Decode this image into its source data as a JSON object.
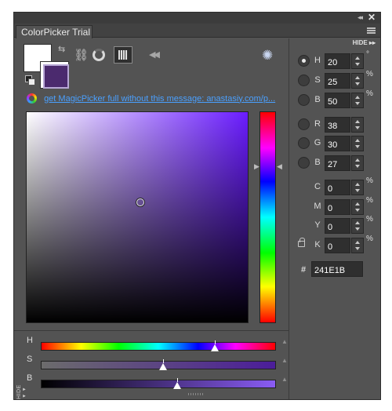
{
  "window": {
    "collapse_glyph": "◂◂",
    "close_glyph": "✕",
    "tab_title": "ColorPicker Trial"
  },
  "toolbar": {
    "swap_glyph": "⇆",
    "link_glyph": "⛓",
    "rewind_glyph": "◀◀",
    "gamut_glyph": "✺"
  },
  "promo": {
    "text": "get MagicPicker full without this message: anastasiy.com/p..."
  },
  "picker": {
    "hue_deg": 20,
    "saturation_pct": 25,
    "brightness_pct": 50
  },
  "sliders": {
    "h_label": "H",
    "s_label": "S",
    "b_label": "B",
    "h_level_pct": 74,
    "s_level_pct": 52,
    "b_level_pct": 58,
    "scroll_up_glyph": "▲"
  },
  "hide_labels": {
    "top": "HIDE ▸▸",
    "bottom": "HIDE ◂◂"
  },
  "fields": {
    "hsb": [
      {
        "label": "H",
        "value": "20",
        "unit": "°",
        "checked": true
      },
      {
        "label": "S",
        "value": "25",
        "unit": "%",
        "checked": false
      },
      {
        "label": "B",
        "value": "50",
        "unit": "%",
        "checked": false
      }
    ],
    "rgb": [
      {
        "label": "R",
        "value": "38"
      },
      {
        "label": "G",
        "value": "30"
      },
      {
        "label": "B",
        "value": "27"
      }
    ],
    "cmyk": [
      {
        "label": "C",
        "value": "0",
        "unit": "%"
      },
      {
        "label": "M",
        "value": "0",
        "unit": "%"
      },
      {
        "label": "Y",
        "value": "0",
        "unit": "%"
      },
      {
        "label": "K",
        "value": "0",
        "unit": "%"
      }
    ],
    "hex": {
      "label": "#",
      "value": "241E1B"
    }
  },
  "colors": {
    "panel_bg": "#535353",
    "foreground_swatch": "#ffffff",
    "background_swatch": "#4b2a6e",
    "link_blue": "#4aa0ff"
  }
}
